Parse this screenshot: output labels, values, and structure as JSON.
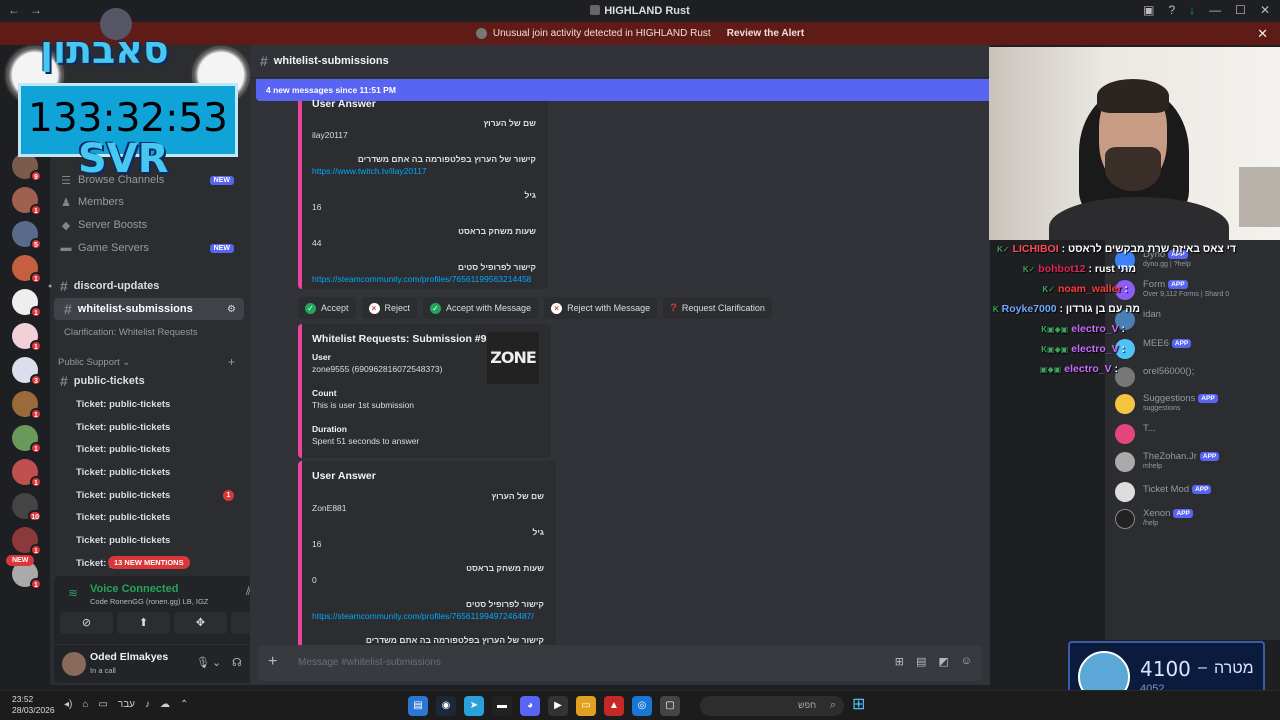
{
  "window": {
    "title": "HIGHLAND Rust"
  },
  "alert": {
    "text": "Unusual join activity detected in HIGHLAND Rust",
    "action": "Review the Alert"
  },
  "overlay": {
    "logo": "סאבתון",
    "timer": "133:32:53",
    "svr": "SVR"
  },
  "sidebar": {
    "new_badge": "NEW",
    "items": [
      {
        "label": "Browse Channels",
        "tag": "NEW"
      },
      {
        "label": "Members"
      },
      {
        "label": "Server Boosts"
      },
      {
        "label": "Game Servers",
        "tag": "NEW"
      }
    ],
    "channels": [
      {
        "label": "discord-updates"
      },
      {
        "label": "whitelist-submissions"
      }
    ],
    "thread": "Clarification: Whitelist Requests",
    "category": "Public Support",
    "public_tickets": "public-tickets",
    "tickets": [
      "Ticket: public-tickets",
      "Ticket: public-tickets",
      "Ticket: public-tickets",
      "Ticket: public-tickets",
      "Ticket: public-tickets",
      "Ticket: public-tickets",
      "Ticket: public-tickets",
      "Ticket: p"
    ],
    "ticket_badge": "1",
    "mentions": "13 NEW MENTIONS"
  },
  "server_badges": [
    "9",
    "1",
    "5",
    "1",
    "1",
    "1",
    "3",
    "1",
    "1",
    "1",
    "10",
    "1",
    "1",
    "1"
  ],
  "voice": {
    "status": "Voice Connected",
    "sub": "Code RonenGG (ronen.gg) LB, IGZ"
  },
  "user": {
    "name": "Oded Elmakyes",
    "status": "In a call"
  },
  "channel": {
    "name": "whitelist-submissions",
    "new_messages": "4 new messages since 11:51 PM"
  },
  "embed1": {
    "title": "User Answer",
    "f1_label": "שם של הערוץ",
    "f1_value": "ilay20117",
    "f2_label": "קישור של הערוץ בפלטפורמה בה אתם משדרים",
    "f2_value": "https://www.twitch.tv/ilay20117",
    "f3_label": "גיל",
    "f3_value": "16",
    "f4_label": "שעות משחק בראסט",
    "f4_value": "44",
    "f5_label": "קישור לפרופיל סטים",
    "f5_value": "https://steamcommunity.com/profiles/76561199563214458"
  },
  "actions": {
    "accept": "Accept",
    "reject": "Reject",
    "accept_msg": "Accept with Message",
    "reject_msg": "Reject with Message",
    "clarify": "Request Clarification"
  },
  "embed2": {
    "title": "Whitelist Requests: Submission #93",
    "thumb": "ZONE",
    "user_label": "User",
    "user_value": "zone9555 (690962816072548373)",
    "count_label": "Count",
    "count_value": "This is user 1st submission",
    "duration_label": "Duration",
    "duration_value": "Spent 51 seconds to answer"
  },
  "embed3": {
    "title": "User Answer",
    "f1_label": "שם של הערוץ",
    "f1_value": "ZonE881",
    "f2_label": "גיל",
    "f2_value": "16",
    "f3_label": "שעות משחק בראסט",
    "f3_value": "0",
    "f4_label": "קישור לפרופיל סטים",
    "f4_value": "https://steamcommunity.com/profiles/76561199497246487/",
    "f5_label": "קישור של הערוץ בפלטפורמה בה אתם משדרים"
  },
  "composer": {
    "placeholder": "Message #whitelist-submissions"
  },
  "chat_overlay": [
    {
      "user": "LICHIBOI",
      "msg": "די צאס באיזה שרת מבקשים לראסט",
      "color": "#ff4a5a"
    },
    {
      "user": "bohbot12",
      "msg": "rust מתי",
      "color": "#e0245e"
    },
    {
      "user": "noam_waller",
      "msg": "",
      "color": "#ff3b3b"
    },
    {
      "user": "Royke7000",
      "msg": "מה עם בן גורדון",
      "color": "#6fa8ff"
    },
    {
      "user": "electro_V",
      "msg": "",
      "color": "#c86bff"
    },
    {
      "user": "electro_V",
      "msg": "",
      "color": "#c86bff"
    },
    {
      "user": "electro_V",
      "msg": "",
      "color": "#c86bff"
    }
  ],
  "members": [
    {
      "name": "Dyno",
      "sub": "dyno.gg | ?help",
      "app": "APP",
      "color": "#3b82f6"
    },
    {
      "name": "Form",
      "sub": "Over 9,112 Forms | Shard 0",
      "app": "APP",
      "color": "#8b5cf6"
    },
    {
      "name": "idan",
      "sub": "",
      "app": "",
      "color": "#4a7fb5"
    },
    {
      "name": "MEE6",
      "sub": "",
      "app": "APP",
      "color": "#4fc3f7"
    },
    {
      "name": "orel56000();",
      "sub": "",
      "app": "",
      "color": "#777777"
    },
    {
      "name": "Suggestions",
      "sub": "suggestions",
      "app": "APP",
      "color": "#f5c542"
    },
    {
      "name": "T...",
      "sub": "",
      "app": "",
      "color": "#e5457a"
    },
    {
      "name": "TheZohan.Jr",
      "sub": "mhelp",
      "app": "APP",
      "color": "#aaaaaa"
    },
    {
      "name": "Ticket Mod",
      "sub": "",
      "app": "APP",
      "color": "#dddddd"
    },
    {
      "name": "Xenon",
      "sub": "/help",
      "app": "APP",
      "color": "#222222"
    }
  ],
  "goal": {
    "label": "מטרה",
    "dash": "–",
    "value": "4100",
    "current": "4052"
  },
  "taskbar": {
    "time": "23:52",
    "date": "28/03/2026",
    "lang": "עבר",
    "search": "חפש"
  }
}
